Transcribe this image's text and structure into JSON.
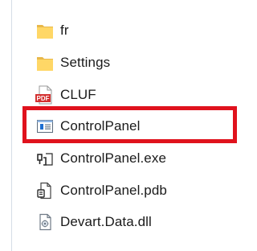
{
  "files": [
    {
      "name": "fr",
      "icon": "folder-icon"
    },
    {
      "name": "Settings",
      "icon": "folder-icon"
    },
    {
      "name": "CLUF",
      "icon": "pdf-icon",
      "icon_text": "PDF"
    },
    {
      "name": "ControlPanel",
      "icon": "window-app-icon"
    },
    {
      "name": "ControlPanel.exe",
      "icon": "exe-icon"
    },
    {
      "name": "ControlPanel.pdb",
      "icon": "pdb-icon"
    },
    {
      "name": "Devart.Data.dll",
      "icon": "dll-icon"
    }
  ],
  "highlight": {
    "target": "ControlPanel",
    "color": "#e0121d"
  },
  "colors": {
    "folder": "#ffd766",
    "pdf_red": "#d32f2f",
    "window_blue": "#1f6fd1"
  }
}
